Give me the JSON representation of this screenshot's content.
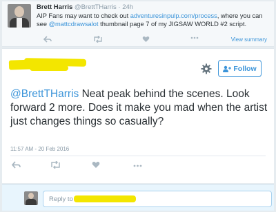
{
  "parent_tweet": {
    "author_name": "Brett Harris",
    "author_handle": "@BrettTHarris",
    "time": "· 24h",
    "text_before": "AIP Fans may want to check out ",
    "link": "adventuresinpulp.com/process",
    "text_middle": ", where you can see ",
    "mention": "@mattcdrawsalot",
    "text_after": " thumbnail page 7 of my JIGSAW WORLD #2 script.",
    "view_summary": "View summary"
  },
  "main_tweet": {
    "follow_label": "Follow",
    "mention": "@BrettTHarris",
    "text": " Neat peak behind the scenes. Look forward 2 more. Does it make you mad when the artist just changes things so casually?",
    "timestamp": "11:57 AM - 20 Feb 2016"
  },
  "reply": {
    "placeholder": "Reply to"
  },
  "colors": {
    "link": "#3b94d9",
    "redaction": "#f3e600",
    "background": "#e6ecf0"
  }
}
